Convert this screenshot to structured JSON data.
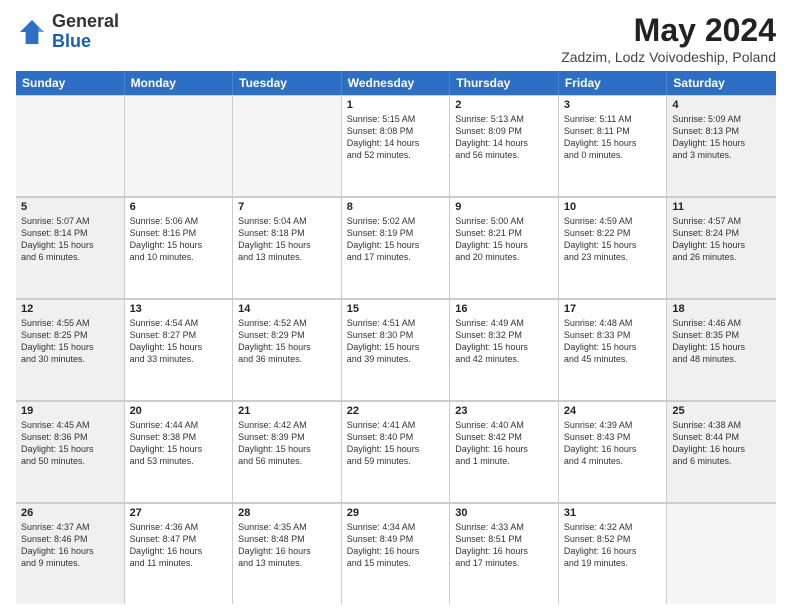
{
  "header": {
    "logo_general": "General",
    "logo_blue": "Blue",
    "title": "May 2024",
    "subtitle": "Zadzim, Lodz Voivodeship, Poland"
  },
  "days_of_week": [
    "Sunday",
    "Monday",
    "Tuesday",
    "Wednesday",
    "Thursday",
    "Friday",
    "Saturday"
  ],
  "rows": [
    [
      {
        "day": "",
        "text": "",
        "empty": true
      },
      {
        "day": "",
        "text": "",
        "empty": true
      },
      {
        "day": "",
        "text": "",
        "empty": true
      },
      {
        "day": "1",
        "text": "Sunrise: 5:15 AM\nSunset: 8:08 PM\nDaylight: 14 hours\nand 52 minutes.",
        "empty": false,
        "shaded": false
      },
      {
        "day": "2",
        "text": "Sunrise: 5:13 AM\nSunset: 8:09 PM\nDaylight: 14 hours\nand 56 minutes.",
        "empty": false,
        "shaded": false
      },
      {
        "day": "3",
        "text": "Sunrise: 5:11 AM\nSunset: 8:11 PM\nDaylight: 15 hours\nand 0 minutes.",
        "empty": false,
        "shaded": false
      },
      {
        "day": "4",
        "text": "Sunrise: 5:09 AM\nSunset: 8:13 PM\nDaylight: 15 hours\nand 3 minutes.",
        "empty": false,
        "shaded": true
      }
    ],
    [
      {
        "day": "5",
        "text": "Sunrise: 5:07 AM\nSunset: 8:14 PM\nDaylight: 15 hours\nand 6 minutes.",
        "empty": false,
        "shaded": true
      },
      {
        "day": "6",
        "text": "Sunrise: 5:06 AM\nSunset: 8:16 PM\nDaylight: 15 hours\nand 10 minutes.",
        "empty": false,
        "shaded": false
      },
      {
        "day": "7",
        "text": "Sunrise: 5:04 AM\nSunset: 8:18 PM\nDaylight: 15 hours\nand 13 minutes.",
        "empty": false,
        "shaded": false
      },
      {
        "day": "8",
        "text": "Sunrise: 5:02 AM\nSunset: 8:19 PM\nDaylight: 15 hours\nand 17 minutes.",
        "empty": false,
        "shaded": false
      },
      {
        "day": "9",
        "text": "Sunrise: 5:00 AM\nSunset: 8:21 PM\nDaylight: 15 hours\nand 20 minutes.",
        "empty": false,
        "shaded": false
      },
      {
        "day": "10",
        "text": "Sunrise: 4:59 AM\nSunset: 8:22 PM\nDaylight: 15 hours\nand 23 minutes.",
        "empty": false,
        "shaded": false
      },
      {
        "day": "11",
        "text": "Sunrise: 4:57 AM\nSunset: 8:24 PM\nDaylight: 15 hours\nand 26 minutes.",
        "empty": false,
        "shaded": true
      }
    ],
    [
      {
        "day": "12",
        "text": "Sunrise: 4:55 AM\nSunset: 8:25 PM\nDaylight: 15 hours\nand 30 minutes.",
        "empty": false,
        "shaded": true
      },
      {
        "day": "13",
        "text": "Sunrise: 4:54 AM\nSunset: 8:27 PM\nDaylight: 15 hours\nand 33 minutes.",
        "empty": false,
        "shaded": false
      },
      {
        "day": "14",
        "text": "Sunrise: 4:52 AM\nSunset: 8:29 PM\nDaylight: 15 hours\nand 36 minutes.",
        "empty": false,
        "shaded": false
      },
      {
        "day": "15",
        "text": "Sunrise: 4:51 AM\nSunset: 8:30 PM\nDaylight: 15 hours\nand 39 minutes.",
        "empty": false,
        "shaded": false
      },
      {
        "day": "16",
        "text": "Sunrise: 4:49 AM\nSunset: 8:32 PM\nDaylight: 15 hours\nand 42 minutes.",
        "empty": false,
        "shaded": false
      },
      {
        "day": "17",
        "text": "Sunrise: 4:48 AM\nSunset: 8:33 PM\nDaylight: 15 hours\nand 45 minutes.",
        "empty": false,
        "shaded": false
      },
      {
        "day": "18",
        "text": "Sunrise: 4:46 AM\nSunset: 8:35 PM\nDaylight: 15 hours\nand 48 minutes.",
        "empty": false,
        "shaded": true
      }
    ],
    [
      {
        "day": "19",
        "text": "Sunrise: 4:45 AM\nSunset: 8:36 PM\nDaylight: 15 hours\nand 50 minutes.",
        "empty": false,
        "shaded": true
      },
      {
        "day": "20",
        "text": "Sunrise: 4:44 AM\nSunset: 8:38 PM\nDaylight: 15 hours\nand 53 minutes.",
        "empty": false,
        "shaded": false
      },
      {
        "day": "21",
        "text": "Sunrise: 4:42 AM\nSunset: 8:39 PM\nDaylight: 15 hours\nand 56 minutes.",
        "empty": false,
        "shaded": false
      },
      {
        "day": "22",
        "text": "Sunrise: 4:41 AM\nSunset: 8:40 PM\nDaylight: 15 hours\nand 59 minutes.",
        "empty": false,
        "shaded": false
      },
      {
        "day": "23",
        "text": "Sunrise: 4:40 AM\nSunset: 8:42 PM\nDaylight: 16 hours\nand 1 minute.",
        "empty": false,
        "shaded": false
      },
      {
        "day": "24",
        "text": "Sunrise: 4:39 AM\nSunset: 8:43 PM\nDaylight: 16 hours\nand 4 minutes.",
        "empty": false,
        "shaded": false
      },
      {
        "day": "25",
        "text": "Sunrise: 4:38 AM\nSunset: 8:44 PM\nDaylight: 16 hours\nand 6 minutes.",
        "empty": false,
        "shaded": true
      }
    ],
    [
      {
        "day": "26",
        "text": "Sunrise: 4:37 AM\nSunset: 8:46 PM\nDaylight: 16 hours\nand 9 minutes.",
        "empty": false,
        "shaded": true
      },
      {
        "day": "27",
        "text": "Sunrise: 4:36 AM\nSunset: 8:47 PM\nDaylight: 16 hours\nand 11 minutes.",
        "empty": false,
        "shaded": false
      },
      {
        "day": "28",
        "text": "Sunrise: 4:35 AM\nSunset: 8:48 PM\nDaylight: 16 hours\nand 13 minutes.",
        "empty": false,
        "shaded": false
      },
      {
        "day": "29",
        "text": "Sunrise: 4:34 AM\nSunset: 8:49 PM\nDaylight: 16 hours\nand 15 minutes.",
        "empty": false,
        "shaded": false
      },
      {
        "day": "30",
        "text": "Sunrise: 4:33 AM\nSunset: 8:51 PM\nDaylight: 16 hours\nand 17 minutes.",
        "empty": false,
        "shaded": false
      },
      {
        "day": "31",
        "text": "Sunrise: 4:32 AM\nSunset: 8:52 PM\nDaylight: 16 hours\nand 19 minutes.",
        "empty": false,
        "shaded": false
      },
      {
        "day": "",
        "text": "",
        "empty": true
      }
    ]
  ]
}
